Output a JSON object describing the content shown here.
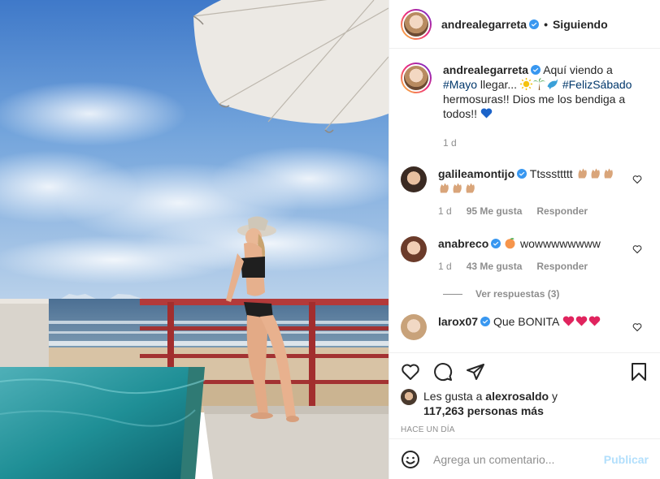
{
  "post": {
    "author": "andrealegarreta",
    "follow_separator": "•",
    "follow_label": "Siguiendo"
  },
  "caption": {
    "username": "andrealegarreta",
    "text_1": "Aquí viendo a",
    "hashtag_1": "#Mayo",
    "text_2": "llegar...",
    "hashtag_2": "#FelizSábado",
    "text_3": "hermosuras!! Dios me los bendiga a todos!!",
    "time": "1 d"
  },
  "comments": [
    {
      "username": "galileamontijo",
      "text": "Ttsssttttt",
      "time": "1 d",
      "likes": "95 Me gusta",
      "reply": "Responder"
    },
    {
      "username": "anabreco",
      "text": "wowwwwwwww",
      "time": "1 d",
      "likes": "43 Me gusta",
      "reply": "Responder"
    },
    {
      "username": "larox07",
      "text": "Que BONITA"
    }
  ],
  "view_replies": "Ver respuestas (3)",
  "likes_line": {
    "prefix": "Les gusta a",
    "user": "alexrosaldo",
    "suffix": "y",
    "count": "117,263 personas más"
  },
  "timestamp": "HACE UN DÍA",
  "add_comment": {
    "placeholder": "Agrega un comentario...",
    "publish_label": "Publicar"
  },
  "colors": {
    "verified": "#3897f0",
    "link": "#00376b",
    "heart_emoji": "#e0245e",
    "blue_heart": "#1b63c9",
    "publish_disabled": "#b2dffc"
  },
  "icons": [
    "verified-icon",
    "heart-icon",
    "comment-icon",
    "share-icon",
    "bookmark-icon",
    "smile-icon",
    "small-heart-icon"
  ]
}
